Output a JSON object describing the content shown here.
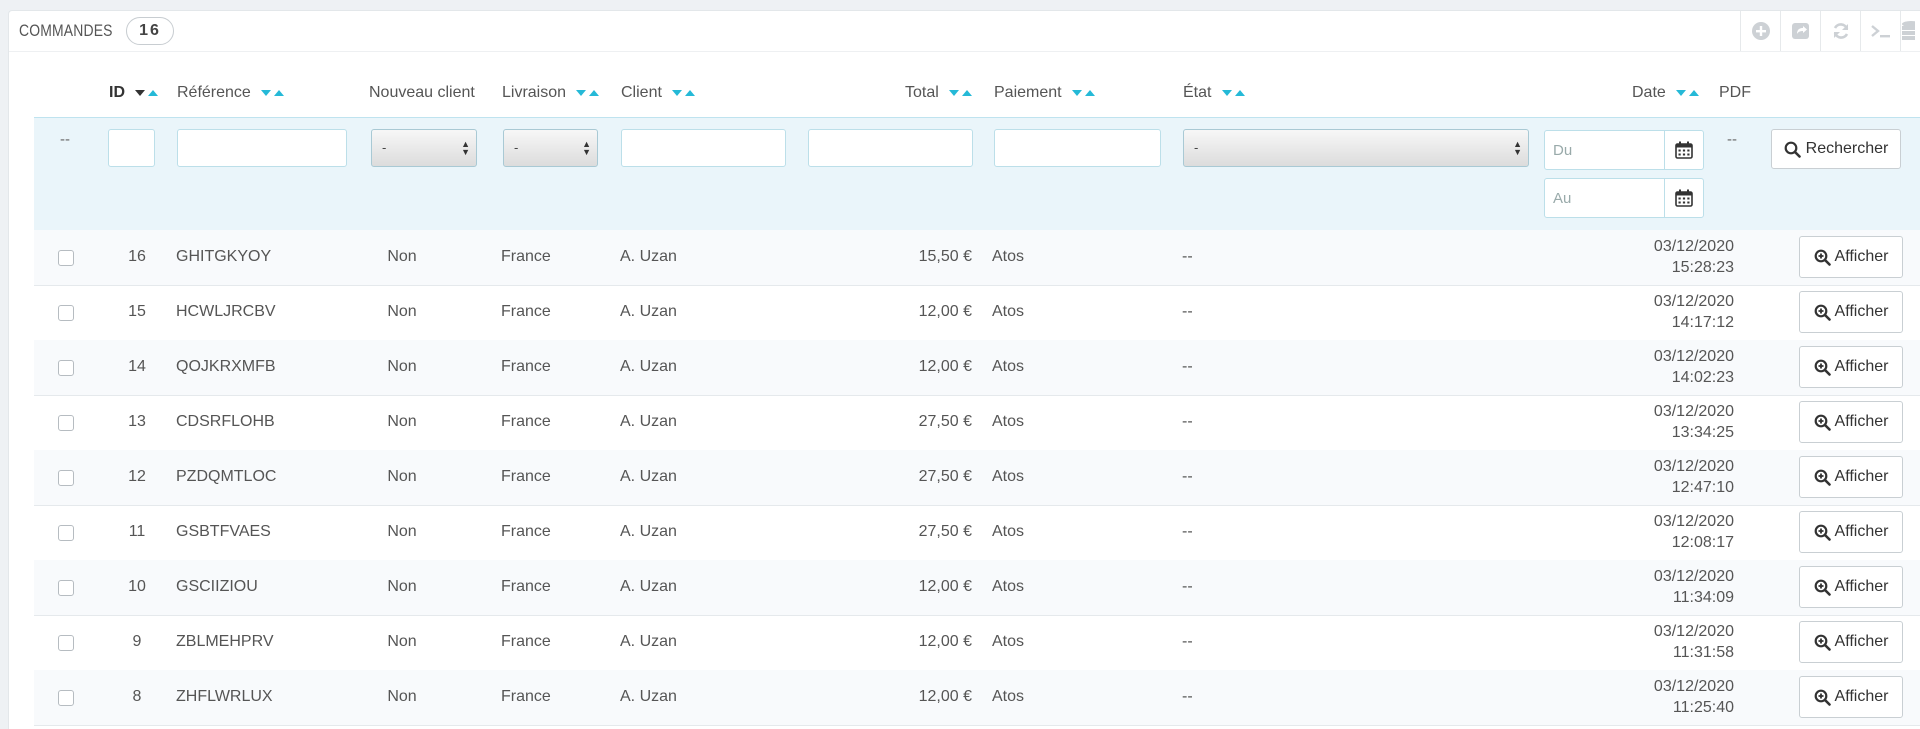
{
  "panel": {
    "title": "COMMANDES",
    "count": "16"
  },
  "toolbar": [
    "add-icon",
    "export-icon",
    "refresh-icon",
    "sql-query-icon",
    "database-icon"
  ],
  "columns": {
    "id": "ID",
    "reference": "Référence",
    "new_client": "Nouveau client",
    "delivery": "Livraison",
    "client": "Client",
    "total": "Total",
    "payment": "Paiement",
    "state": "État",
    "date": "Date",
    "pdf": "PDF"
  },
  "filters": {
    "bulk": "--",
    "new_client_select": "-",
    "delivery_select": "-",
    "state_select": "-",
    "date_from_placeholder": "Du",
    "date_to_placeholder": "Au",
    "pdf": "--",
    "search_button": "Rechercher"
  },
  "rows": [
    {
      "id": "16",
      "ref": "GHITGKYOY",
      "new": "Non",
      "country": "France",
      "client": "A. Uzan",
      "total": "15,50 €",
      "payment": "Atos",
      "state": "--",
      "date": "03/12/2020",
      "time": "15:28:23",
      "action": "Afficher"
    },
    {
      "id": "15",
      "ref": "HCWLJRCBV",
      "new": "Non",
      "country": "France",
      "client": "A. Uzan",
      "total": "12,00 €",
      "payment": "Atos",
      "state": "--",
      "date": "03/12/2020",
      "time": "14:17:12",
      "action": "Afficher"
    },
    {
      "id": "14",
      "ref": "QOJKRXMFB",
      "new": "Non",
      "country": "France",
      "client": "A. Uzan",
      "total": "12,00 €",
      "payment": "Atos",
      "state": "--",
      "date": "03/12/2020",
      "time": "14:02:23",
      "action": "Afficher"
    },
    {
      "id": "13",
      "ref": "CDSRFLOHB",
      "new": "Non",
      "country": "France",
      "client": "A. Uzan",
      "total": "27,50 €",
      "payment": "Atos",
      "state": "--",
      "date": "03/12/2020",
      "time": "13:34:25",
      "action": "Afficher"
    },
    {
      "id": "12",
      "ref": "PZDQMTLOC",
      "new": "Non",
      "country": "France",
      "client": "A. Uzan",
      "total": "27,50 €",
      "payment": "Atos",
      "state": "--",
      "date": "03/12/2020",
      "time": "12:47:10",
      "action": "Afficher"
    },
    {
      "id": "11",
      "ref": "GSBTFVAES",
      "new": "Non",
      "country": "France",
      "client": "A. Uzan",
      "total": "27,50 €",
      "payment": "Atos",
      "state": "--",
      "date": "03/12/2020",
      "time": "12:08:17",
      "action": "Afficher"
    },
    {
      "id": "10",
      "ref": "GSCIIZIOU",
      "new": "Non",
      "country": "France",
      "client": "A. Uzan",
      "total": "12,00 €",
      "payment": "Atos",
      "state": "--",
      "date": "03/12/2020",
      "time": "11:34:09",
      "action": "Afficher"
    },
    {
      "id": "9",
      "ref": "ZBLMEHPRV",
      "new": "Non",
      "country": "France",
      "client": "A. Uzan",
      "total": "12,00 €",
      "payment": "Atos",
      "state": "--",
      "date": "03/12/2020",
      "time": "11:31:58",
      "action": "Afficher"
    },
    {
      "id": "8",
      "ref": "ZHFLWRLUX",
      "new": "Non",
      "country": "France",
      "client": "A. Uzan",
      "total": "12,00 €",
      "payment": "Atos",
      "state": "--",
      "date": "03/12/2020",
      "time": "11:25:40",
      "action": "Afficher"
    }
  ],
  "colors": {
    "accent": "#25b9d7",
    "filter_bg": "#eaf5fa"
  }
}
